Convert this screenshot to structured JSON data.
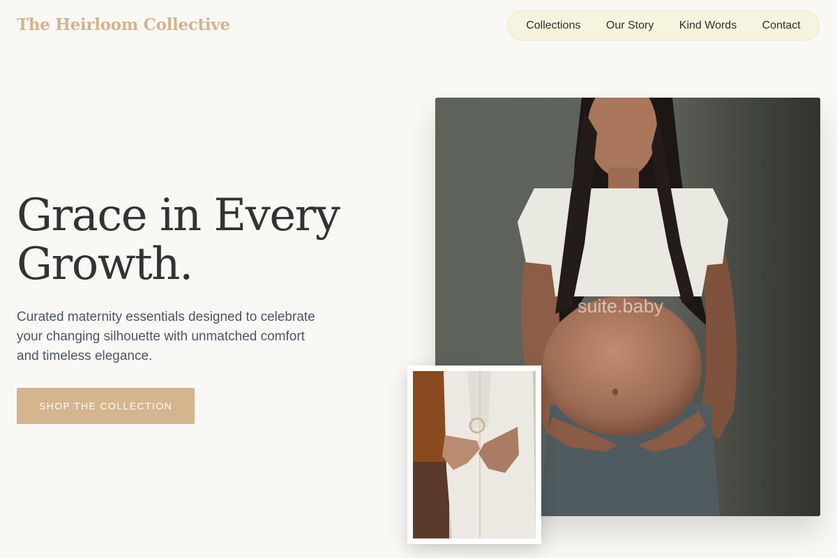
{
  "header": {
    "brand": "The Heirloom Collective",
    "nav": [
      "Collections",
      "Our Story",
      "Kind Words",
      "Contact"
    ]
  },
  "hero": {
    "title_line1": "Grace in Every",
    "title_line2": "Growth.",
    "subtitle": "Curated maternity essentials designed to celebrate your changing silhouette with unmatched comfort and timeless elegance.",
    "cta": "SHOP THE COLLECTION"
  },
  "media": {
    "main_watermark": "suite.baby"
  },
  "colors": {
    "accent": "#d3b58e",
    "background": "#faf8f5",
    "nav_bg": "#f6f3de",
    "heading": "#333333",
    "body_text": "#4e5564"
  }
}
